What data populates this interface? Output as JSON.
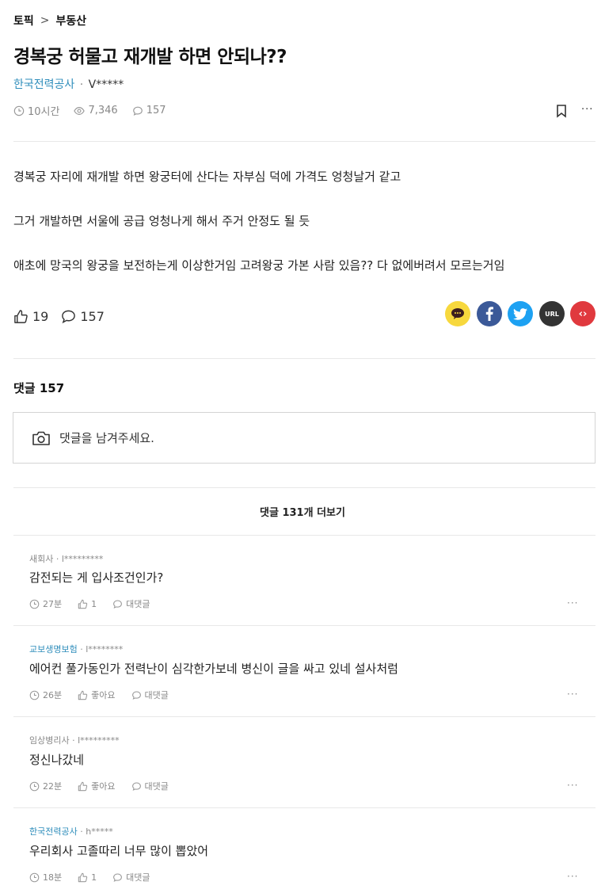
{
  "breadcrumb": {
    "root": "토픽",
    "separator": ">",
    "current": "부동산"
  },
  "post": {
    "title": "경복궁 허물고 재개발 하면 안되나??",
    "company": "한국전력공사",
    "dot": "·",
    "nickname": "V*****",
    "time": "10시간",
    "views": "7,346",
    "comments": "157",
    "more": "···",
    "paragraphs": [
      "경복궁 자리에 재개발 하면 왕궁터에 산다는 자부심 덕에 가격도 엉청날거 같고",
      "그거 개발하면 서울에 공급 엉청나게 해서 주거 안정도 될 듯",
      "애초에 망국의 왕궁을 보전하는게 이상한거임 고려왕궁 가본 사람 있음?? 다 없에버려서 모르는거임"
    ],
    "likes": "19",
    "comment_count": "157"
  },
  "share": {
    "kakao_color": "#f7d83d",
    "facebook_color": "#3b5998",
    "twitter_color": "#1da1f2",
    "url_label": "URL",
    "url_color": "#333333",
    "embed_label": "‹›",
    "embed_color": "#e0393e"
  },
  "comments_section": {
    "heading": "댓글 157",
    "input_placeholder": "댓글을 남겨주세요.",
    "more_label": "댓글 131개 더보기"
  },
  "comments": [
    {
      "company": "새회사",
      "company_blue": false,
      "dot": "·",
      "nickname": "l*********",
      "text": "감전되는 게 입사조건인가?",
      "time": "27분",
      "like": "1",
      "reply": "대댓글",
      "more": "···"
    },
    {
      "company": "교보생명보험",
      "company_blue": true,
      "dot": "·",
      "nickname": "l********",
      "text": "에어컨 풀가동인가 전력난이 심각한가보네 병신이 글을 싸고 있네 설사처럼",
      "time": "26분",
      "like": "좋아요",
      "reply": "대댓글",
      "more": "···"
    },
    {
      "company": "임상병리사",
      "company_blue": false,
      "dot": "·",
      "nickname": "l*********",
      "text": "정신나갔네",
      "time": "22분",
      "like": "좋아요",
      "reply": "대댓글",
      "more": "···"
    },
    {
      "company": "한국전력공사",
      "company_blue": true,
      "dot": "·",
      "nickname": "h*****",
      "text": "우리회사 고졸따리 너무 많이 뽑았어",
      "time": "18분",
      "like": "1",
      "reply": "대댓글",
      "more": "···"
    }
  ]
}
